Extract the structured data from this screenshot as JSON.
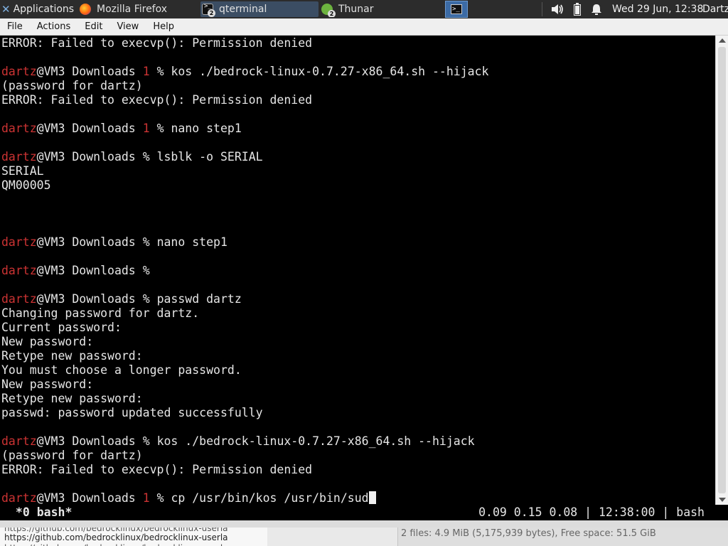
{
  "panel": {
    "applications_label": "Applications",
    "tasks": [
      {
        "label": "Mozilla Firefox",
        "icon": "firefox-icon"
      },
      {
        "label": "qterminal",
        "icon": "terminal-icon",
        "badge": "2"
      },
      {
        "label": "Thunar",
        "icon": "thunar-icon",
        "badge": "2"
      }
    ],
    "clock": "Wed 29 Jun, 12:38",
    "user": "Dartz"
  },
  "menubar": {
    "items": [
      "File",
      "Actions",
      "Edit",
      "View",
      "Help"
    ]
  },
  "terminal": {
    "user": "dartz",
    "host_dir": "@VM3 Downloads ",
    "lines": [
      "ERROR: Failed to execvp(): Permission denied",
      "",
      "kos ./bedrock-linux-0.7.27-x86_64.sh --hijack",
      "(password for dartz)",
      "ERROR: Failed to execvp(): Permission denied",
      "",
      "nano step1",
      "",
      "lsblk -o SERIAL",
      "SERIAL",
      "QM00005",
      "nano step1",
      "passwd dartz",
      "Changing password for dartz.",
      "Current password:",
      "New password:",
      "Retype new password:",
      "You must choose a longer password.",
      "New password:",
      "Retype new password:",
      "passwd: password updated successfully",
      "kos ./bedrock-linux-0.7.27-x86_64.sh --hijack",
      "(password for dartz)",
      "ERROR: Failed to execvp(): Permission denied",
      "cp /usr/bin/kos /usr/bin/sud"
    ],
    "exit_code": "1",
    "prompt_char": "%"
  },
  "status_bar": {
    "left": " *0 bash* ",
    "right": "0.09 0.15 0.08 | 12:38:00 | bash"
  },
  "behind": {
    "url_line": "https://github.com/bedrocklinux/bedrocklinux-userla",
    "thunar_status": "2 files: 4.9 MiB (5,175,939 bytes), Free space: 51.5 GiB"
  },
  "colors": {
    "prompt_user": "#cc3333",
    "exit_code": "#cc3333",
    "panel_bg": "#2c2c2c",
    "active_task": "#3c6ba5"
  }
}
